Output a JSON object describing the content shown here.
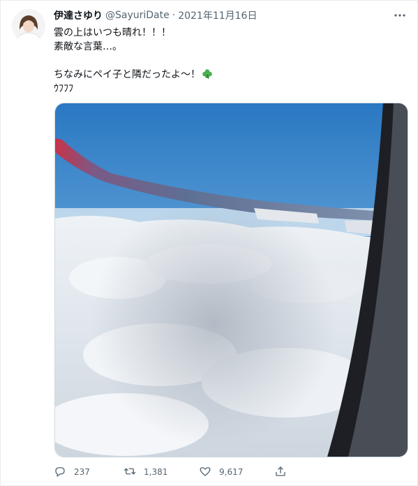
{
  "tweet": {
    "display_name": "伊達さゆり",
    "handle": "@SayuriDate",
    "separator": "·",
    "date": "2021年11月16日",
    "lines": [
      "雲の上はいつも晴れ！！！",
      "素敵な言葉…。",
      "ちなみにペイ子と隣だったよ〜！",
      "ｳﾌﾌﾌ"
    ],
    "emoji": "clover-icon"
  },
  "media": {
    "icon": "airplane-window-photo",
    "colors": {
      "sky_top": "#2f80c8",
      "sky_bottom": "#a9cde8",
      "wing": "#6f7f9f",
      "wingtip": "#d63a4a"
    }
  },
  "actions": {
    "reply_count": "237",
    "retweet_count": "1,381",
    "like_count": "9,617",
    "icons": [
      "reply-icon",
      "retweet-icon",
      "like-icon",
      "share-icon"
    ]
  },
  "colors": {
    "text": "#0f1419",
    "muted": "#536471",
    "border": "#cfd9de",
    "clover": "#4caf50"
  }
}
